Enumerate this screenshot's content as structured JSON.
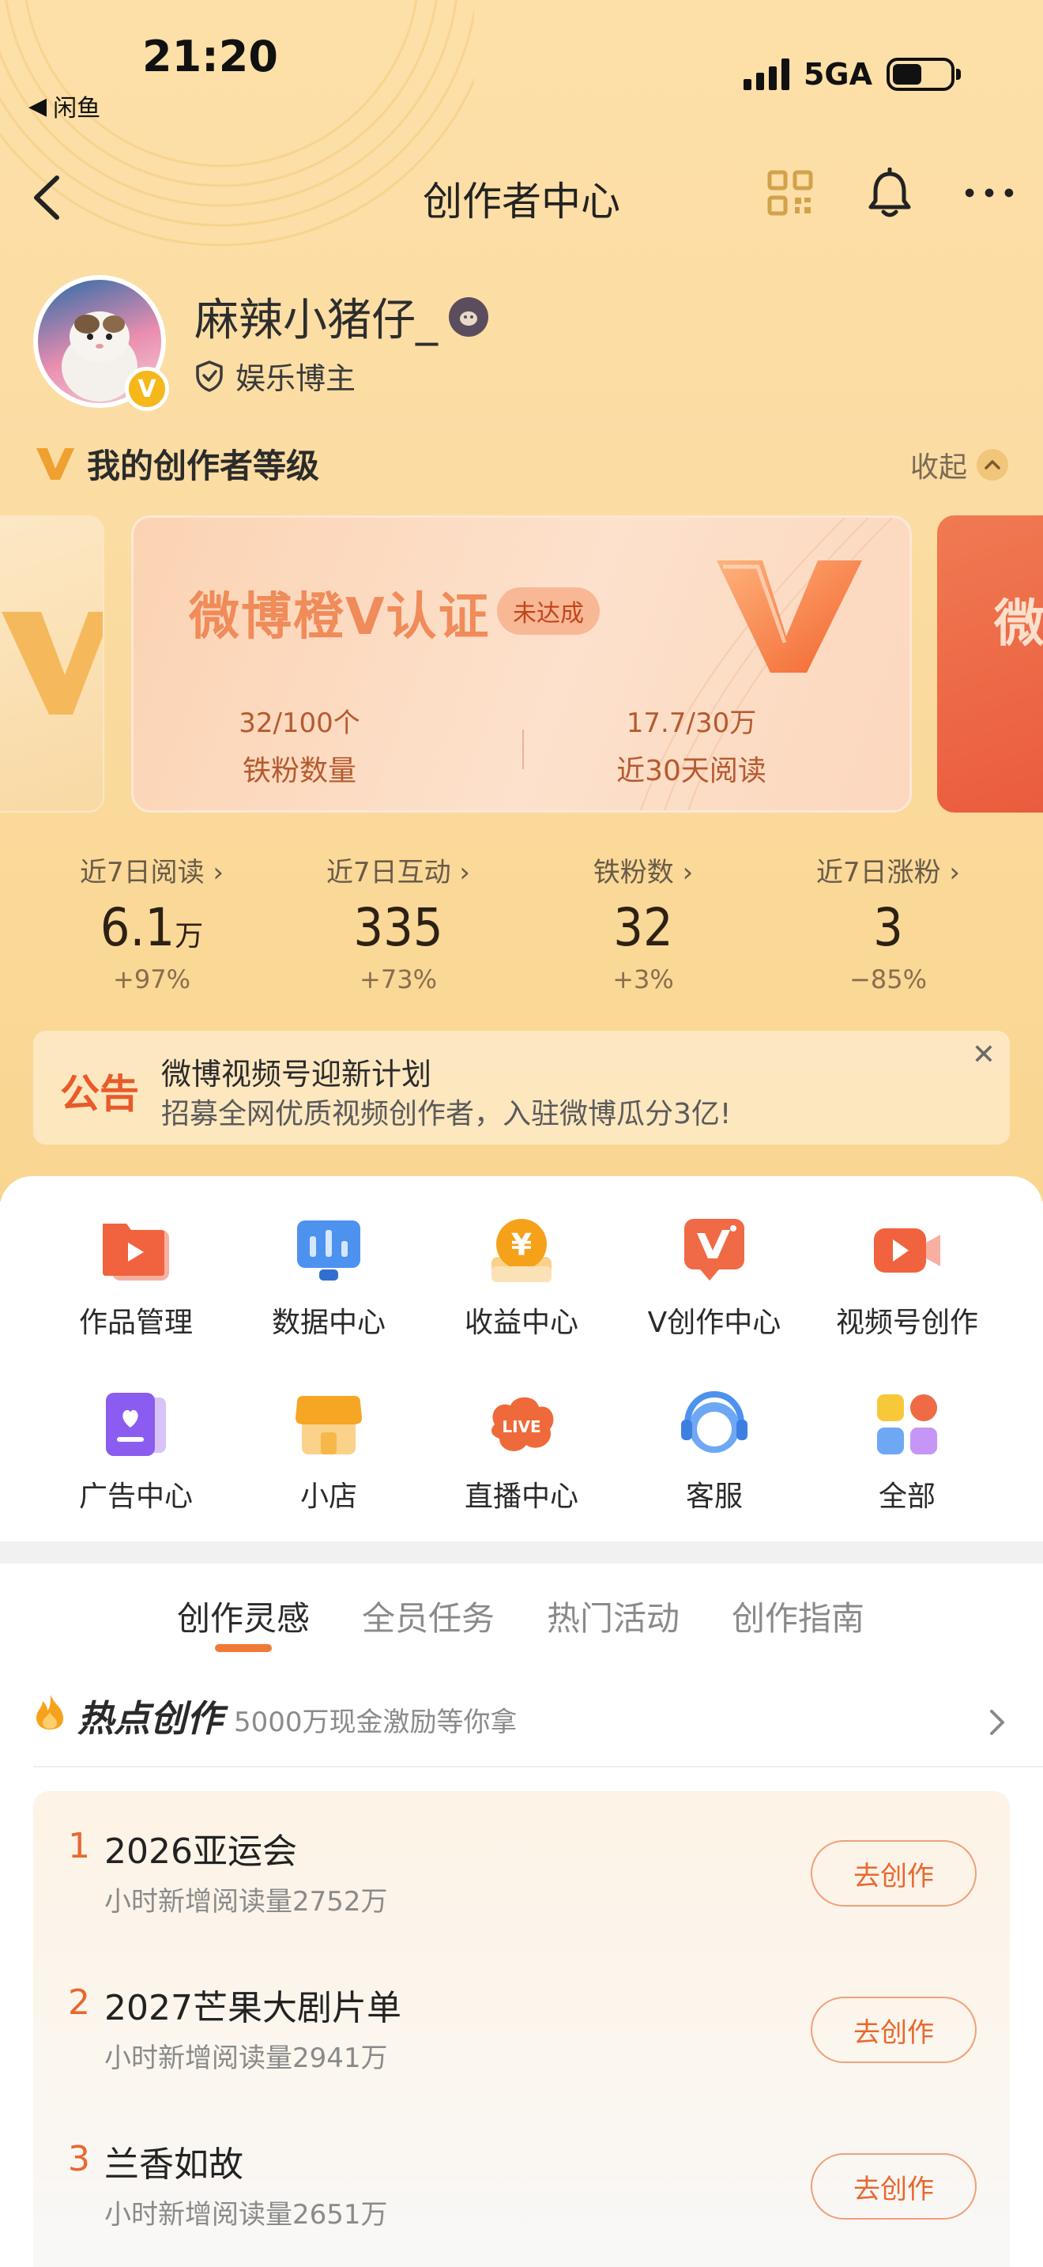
{
  "status_bar": {
    "time": "21:20",
    "back_app": "闲鱼",
    "network": "5GA"
  },
  "nav": {
    "title": "创作者中心",
    "icons": [
      "qrcode-icon",
      "bell-icon",
      "more-icon"
    ]
  },
  "profile": {
    "name": "麻辣小猪仔_",
    "tag": "娱乐博主",
    "avatar_badge": "V"
  },
  "level": {
    "title": "我的创作者等级",
    "collapse_label": "收起"
  },
  "level_card": {
    "title": "微博橙V认证",
    "status": "未达成",
    "stats": [
      {
        "value": "32/100个",
        "label": "铁粉数量"
      },
      {
        "value": "17.7/30万",
        "label": "近30天阅读"
      }
    ],
    "next_card_peek": "微"
  },
  "stats": [
    {
      "label": "近7日阅读",
      "value": "6.1",
      "unit": "万",
      "change": "+97%"
    },
    {
      "label": "近7日互动",
      "value": "335",
      "unit": "",
      "change": "+73%"
    },
    {
      "label": "铁粉数",
      "value": "32",
      "unit": "",
      "change": "+3%"
    },
    {
      "label": "近7日涨粉",
      "value": "3",
      "unit": "",
      "change": "−85%"
    }
  ],
  "notice": {
    "badge": "公告",
    "title": "微博视频号迎新计划",
    "subtitle": "招募全网优质视频创作者，入驻微博瓜分3亿!"
  },
  "tools": [
    {
      "label": "作品管理",
      "icon": "works-icon"
    },
    {
      "label": "数据中心",
      "icon": "data-icon"
    },
    {
      "label": "收益中心",
      "icon": "income-icon"
    },
    {
      "label": "V创作中心",
      "icon": "v-create-icon"
    },
    {
      "label": "视频号创作",
      "icon": "video-icon"
    },
    {
      "label": "广告中心",
      "icon": "ad-icon"
    },
    {
      "label": "小店",
      "icon": "shop-icon"
    },
    {
      "label": "直播中心",
      "icon": "live-icon"
    },
    {
      "label": "客服",
      "icon": "service-icon"
    },
    {
      "label": "全部",
      "icon": "all-icon"
    }
  ],
  "tabs": [
    "创作灵感",
    "全员任务",
    "热门活动",
    "创作指南"
  ],
  "hot": {
    "title": "热点创作",
    "subtitle": "5000万现金激励等你拿",
    "items": [
      {
        "rank": "1",
        "name": "2026亚运会",
        "reads": "小时新增阅读量2752万",
        "button": "去创作"
      },
      {
        "rank": "2",
        "name": "2027芒果大剧片单",
        "reads": "小时新增阅读量2941万",
        "button": "去创作"
      },
      {
        "rank": "3",
        "name": "兰香如故",
        "reads": "小时新增阅读量2651万",
        "button": "去创作"
      }
    ]
  }
}
